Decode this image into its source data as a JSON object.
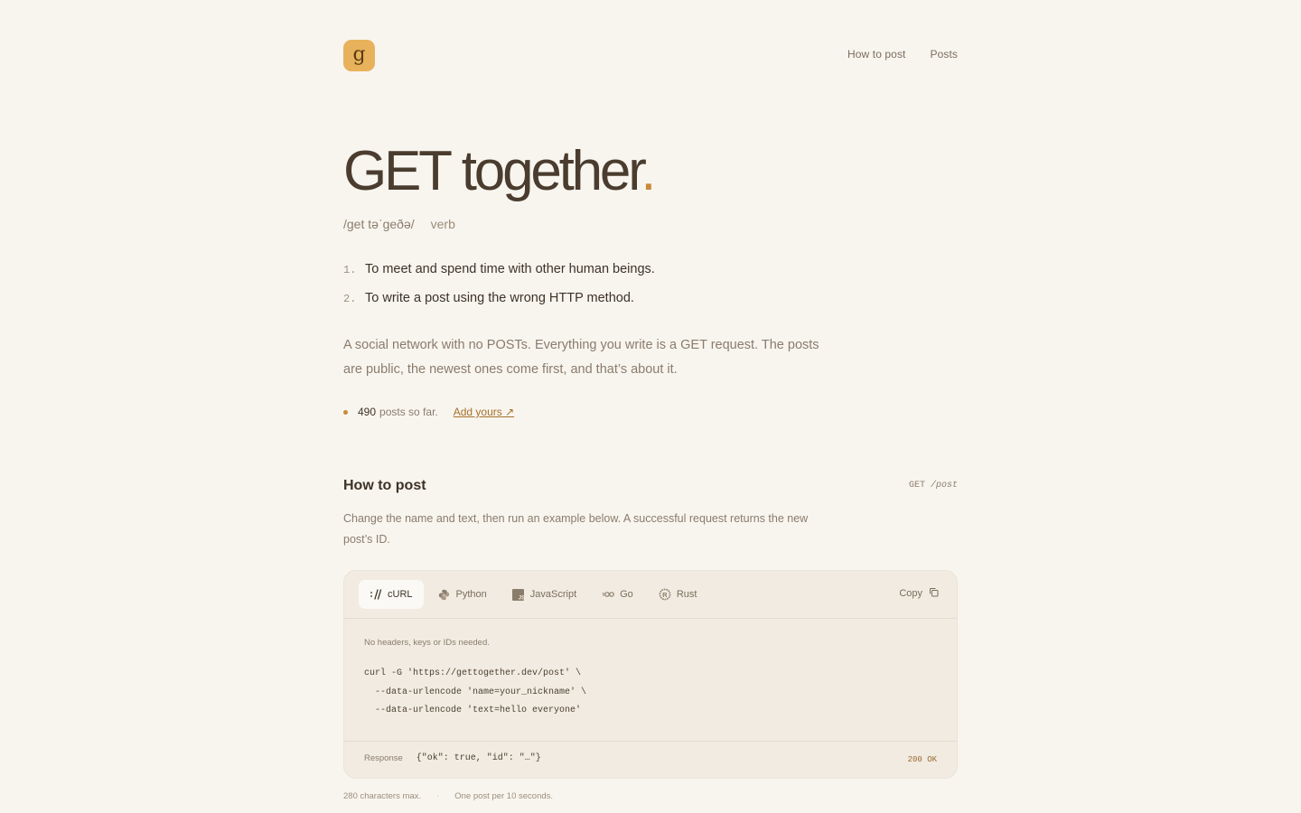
{
  "header": {
    "logo_letter": "g",
    "nav": [
      "How to post",
      "Posts"
    ]
  },
  "hero": {
    "title": "GET together",
    "title_dot": ".",
    "pronunciation": "/get təˈgeðə/",
    "part_of_speech": "verb",
    "definitions": [
      {
        "num": "1.",
        "text": "To meet and spend time with other human beings."
      },
      {
        "num": "2.",
        "text": "To write a post using the wrong HTTP method."
      }
    ],
    "lead": "A social network with no POSTs. Everything you write is a GET request. The posts are public, the newest ones come first, and that’s about it.",
    "stat_count": "490",
    "stat_text": "posts so far.",
    "add_link": "Add yours ↗"
  },
  "how": {
    "title": "How to post",
    "method": "GET",
    "path": "/post",
    "description": "Change the name and text, then run an example below. A successful request returns the new post’s ID.",
    "tabs": [
      {
        "label": "cURL",
        "icon": "curl-icon"
      },
      {
        "label": "Python",
        "icon": "python-icon"
      },
      {
        "label": "JavaScript",
        "icon": "javascript-icon"
      },
      {
        "label": "Go",
        "icon": "go-icon"
      },
      {
        "label": "Rust",
        "icon": "rust-icon"
      }
    ],
    "active_tab": "cURL",
    "copy_label": "Copy",
    "note": "No headers, keys or IDs needed.",
    "code_lines": [
      "curl -G 'https://gettogether.dev/post' \\",
      "  --data-urlencode 'name=your_nickname' \\",
      "  --data-urlencode 'text=hello everyone'"
    ],
    "response_label": "Response",
    "response_value": "{\"ok\": true, \"id\": \"…\"}",
    "status": "200 OK"
  },
  "footer": {
    "limit1": "280 characters max.",
    "separator": "·",
    "limit2": "One post per 10 seconds."
  },
  "colors": {
    "background": "#f8f5ef",
    "accent": "#c98a3a",
    "logo": "#e8b25c",
    "panel": "#f1ebe1"
  }
}
